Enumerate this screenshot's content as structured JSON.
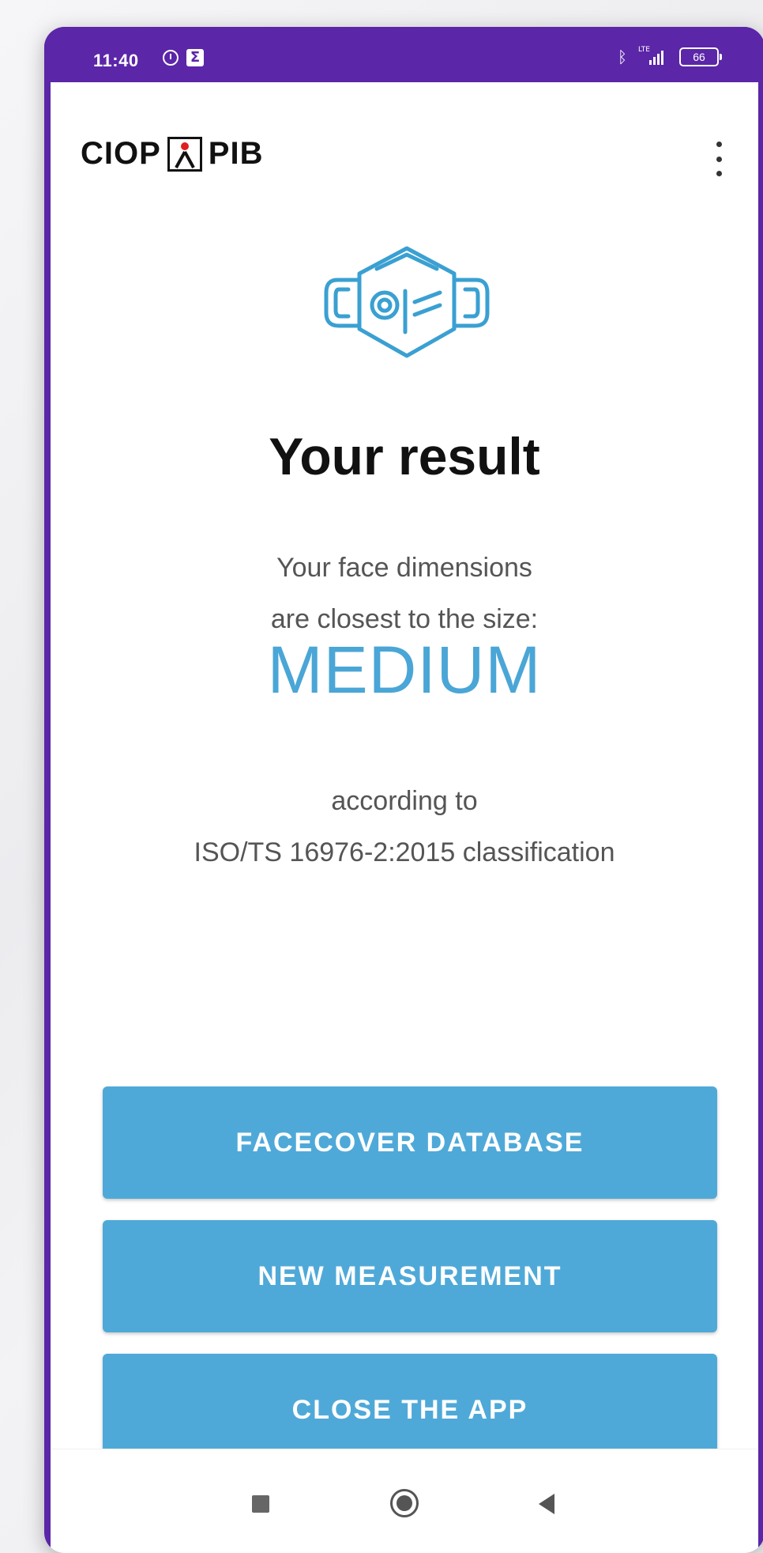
{
  "status_bar": {
    "time": "11:40",
    "battery": "66",
    "network": "LTE",
    "icons": [
      "alarm-icon",
      "sigma-icon",
      "bluetooth-icon",
      "lte-signal-icon",
      "battery-icon"
    ]
  },
  "app_bar": {
    "logo_left": "CIOP",
    "logo_right": "PIB",
    "menu_icon": "more-vert-icon"
  },
  "result": {
    "icon": "face-mask-icon",
    "title": "Your result",
    "line1": "Your face dimensions",
    "line2": "are closest to the size:",
    "size": "MEDIUM",
    "line3": "according to",
    "line4": "ISO/TS 16976-2:2015 classification"
  },
  "buttons": {
    "facecover_database": "FACECOVER DATABASE",
    "new_measurement": "NEW MEASUREMENT",
    "close_app": "CLOSE THE APP"
  },
  "nav_bar": {
    "icons": [
      "recents-icon",
      "home-icon",
      "back-icon"
    ]
  },
  "colors": {
    "accent": "#4fa9d8",
    "size_text": "#4aa6d6",
    "frame": "#5b26a8"
  }
}
